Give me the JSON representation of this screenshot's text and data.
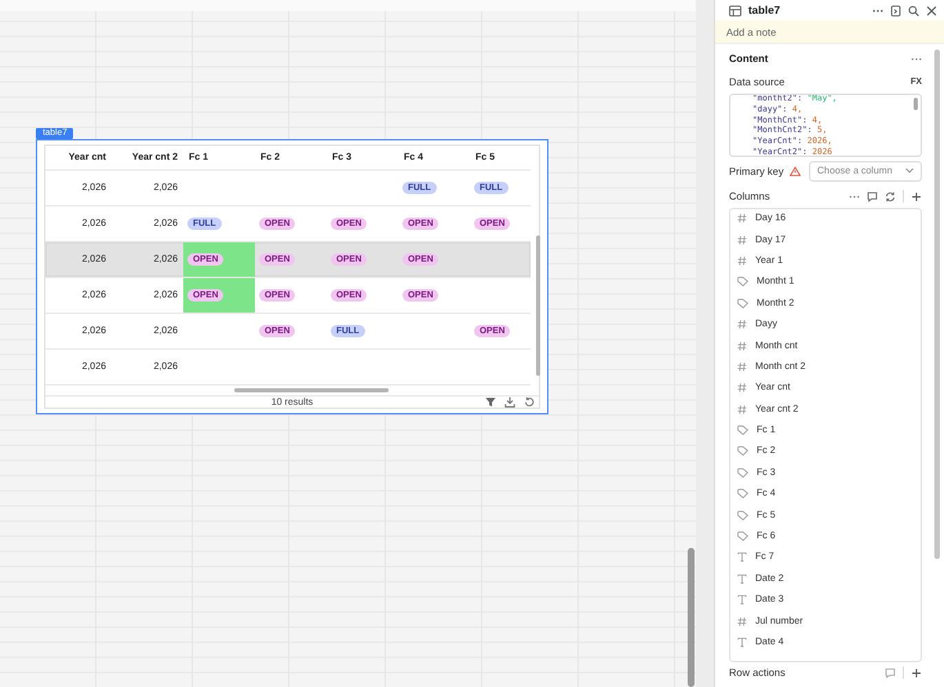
{
  "widget": {
    "label": "table7"
  },
  "table": {
    "columns": [
      "Year cnt",
      "Year cnt 2",
      "Fc 1",
      "Fc 2",
      "Fc 3",
      "Fc 4",
      "Fc 5"
    ],
    "rows": [
      {
        "selected": false,
        "year_cnt": "2,026",
        "year_cnt_2": "2,026",
        "fc_4": {
          "tag": "FULL",
          "kind": "full",
          "highlighted": false
        },
        "fc_5": {
          "tag": "FULL",
          "kind": "full",
          "highlighted": false
        }
      },
      {
        "selected": false,
        "year_cnt": "2,026",
        "year_cnt_2": "2,026",
        "fc_1": {
          "tag": "FULL",
          "kind": "full",
          "highlighted": false
        },
        "fc_2": {
          "tag": "OPEN",
          "kind": "open",
          "highlighted": false
        },
        "fc_3": {
          "tag": "OPEN",
          "kind": "open",
          "highlighted": false
        },
        "fc_4": {
          "tag": "OPEN",
          "kind": "open",
          "highlighted": false
        },
        "fc_5": {
          "tag": "OPEN",
          "kind": "open",
          "highlighted": false
        }
      },
      {
        "selected": true,
        "year_cnt": "2,026",
        "year_cnt_2": "2,026",
        "fc_1": {
          "tag": "OPEN",
          "kind": "open",
          "highlighted": true
        },
        "fc_2": {
          "tag": "OPEN",
          "kind": "open",
          "highlighted": false
        },
        "fc_3": {
          "tag": "OPEN",
          "kind": "open",
          "highlighted": false
        },
        "fc_4": {
          "tag": "OPEN",
          "kind": "open",
          "highlighted": false
        }
      },
      {
        "selected": false,
        "year_cnt": "2,026",
        "year_cnt_2": "2,026",
        "fc_1": {
          "tag": "OPEN",
          "kind": "open",
          "highlighted": true
        },
        "fc_2": {
          "tag": "OPEN",
          "kind": "open",
          "highlighted": false
        },
        "fc_3": {
          "tag": "OPEN",
          "kind": "open",
          "highlighted": false
        },
        "fc_4": {
          "tag": "OPEN",
          "kind": "open",
          "highlighted": false
        }
      },
      {
        "selected": false,
        "year_cnt": "2,026",
        "year_cnt_2": "2,026",
        "fc_2": {
          "tag": "OPEN",
          "kind": "open",
          "highlighted": false
        },
        "fc_3": {
          "tag": "FULL",
          "kind": "full",
          "highlighted": false
        },
        "fc_5": {
          "tag": "OPEN",
          "kind": "open",
          "highlighted": false
        }
      },
      {
        "selected": false,
        "year_cnt": "2,026",
        "year_cnt_2": "2,026"
      }
    ],
    "footer": "10 results"
  },
  "panel": {
    "title": "table7",
    "note_placeholder": "Add a note",
    "section": "Content",
    "data_source_label": "Data source",
    "fx": "FX",
    "code": [
      {
        "key": "\"montht2\":",
        "value": "\"May\",",
        "kind": "string"
      },
      {
        "key": "\"dayy\":",
        "value": "4,",
        "kind": "number"
      },
      {
        "key": "\"MonthCnt\":",
        "value": "4,",
        "kind": "number"
      },
      {
        "key": "\"MonthCnt2\":",
        "value": "5,",
        "kind": "number"
      },
      {
        "key": "\"YearCnt\":",
        "value": "2026,",
        "kind": "number"
      },
      {
        "key": "\"YearCnt2\":",
        "value": "2026",
        "kind": "number"
      }
    ],
    "primary_key_label": "Primary key",
    "primary_key_placeholder": "Choose a column",
    "columns_label": "Columns",
    "columns": [
      {
        "name": "Day 16",
        "kind": "number"
      },
      {
        "name": "Day 17",
        "kind": "number"
      },
      {
        "name": "Year 1",
        "kind": "number"
      },
      {
        "name": "Montht 1",
        "kind": "tag"
      },
      {
        "name": "Montht 2",
        "kind": "tag"
      },
      {
        "name": "Dayy",
        "kind": "number"
      },
      {
        "name": "Month cnt",
        "kind": "number"
      },
      {
        "name": "Month cnt 2",
        "kind": "number"
      },
      {
        "name": "Year cnt",
        "kind": "number"
      },
      {
        "name": "Year cnt 2",
        "kind": "number"
      },
      {
        "name": "Fc 1",
        "kind": "tag"
      },
      {
        "name": "Fc 2",
        "kind": "tag"
      },
      {
        "name": "Fc 3",
        "kind": "tag"
      },
      {
        "name": "Fc 4",
        "kind": "tag"
      },
      {
        "name": "Fc 5",
        "kind": "tag"
      },
      {
        "name": "Fc 6",
        "kind": "tag"
      },
      {
        "name": "Fc 7",
        "kind": "text"
      },
      {
        "name": "Date 2",
        "kind": "text"
      },
      {
        "name": "Date 3",
        "kind": "text"
      },
      {
        "name": "Jul number",
        "kind": "number"
      },
      {
        "name": "Date 4",
        "kind": "text"
      }
    ],
    "row_actions_label": "Row actions"
  }
}
